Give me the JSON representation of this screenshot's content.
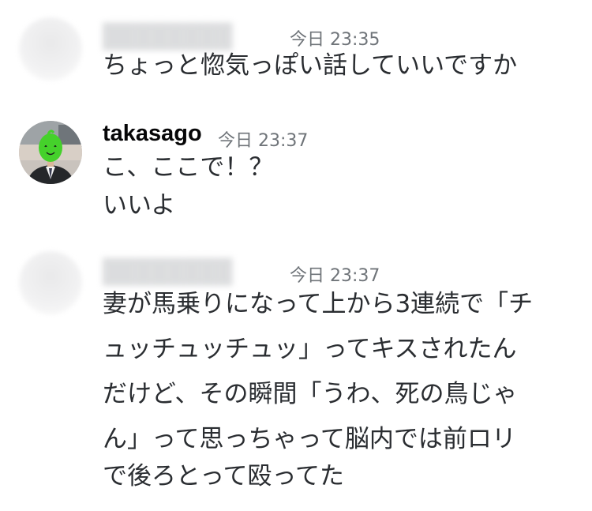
{
  "messages": [
    {
      "author": "",
      "timestamp": "今日 23:35",
      "lines": [
        "ちょっと惚気っぽい話していいですか"
      ]
    },
    {
      "author": "takasago",
      "timestamp": "今日 23:37",
      "lines": [
        "こ、ここで！？",
        "いいよ"
      ]
    },
    {
      "author": "",
      "timestamp": "今日 23:37",
      "lines": [
        "妻が馬乗りになって上から3連続で「チ",
        "ュッチュッチュッ」ってキスされたん",
        "だけど、その瞬間「うわ、死の鳥じゃ",
        "ん」って思っちゃって脳内では前ロリ",
        "で後ろとって殴ってた"
      ]
    }
  ]
}
